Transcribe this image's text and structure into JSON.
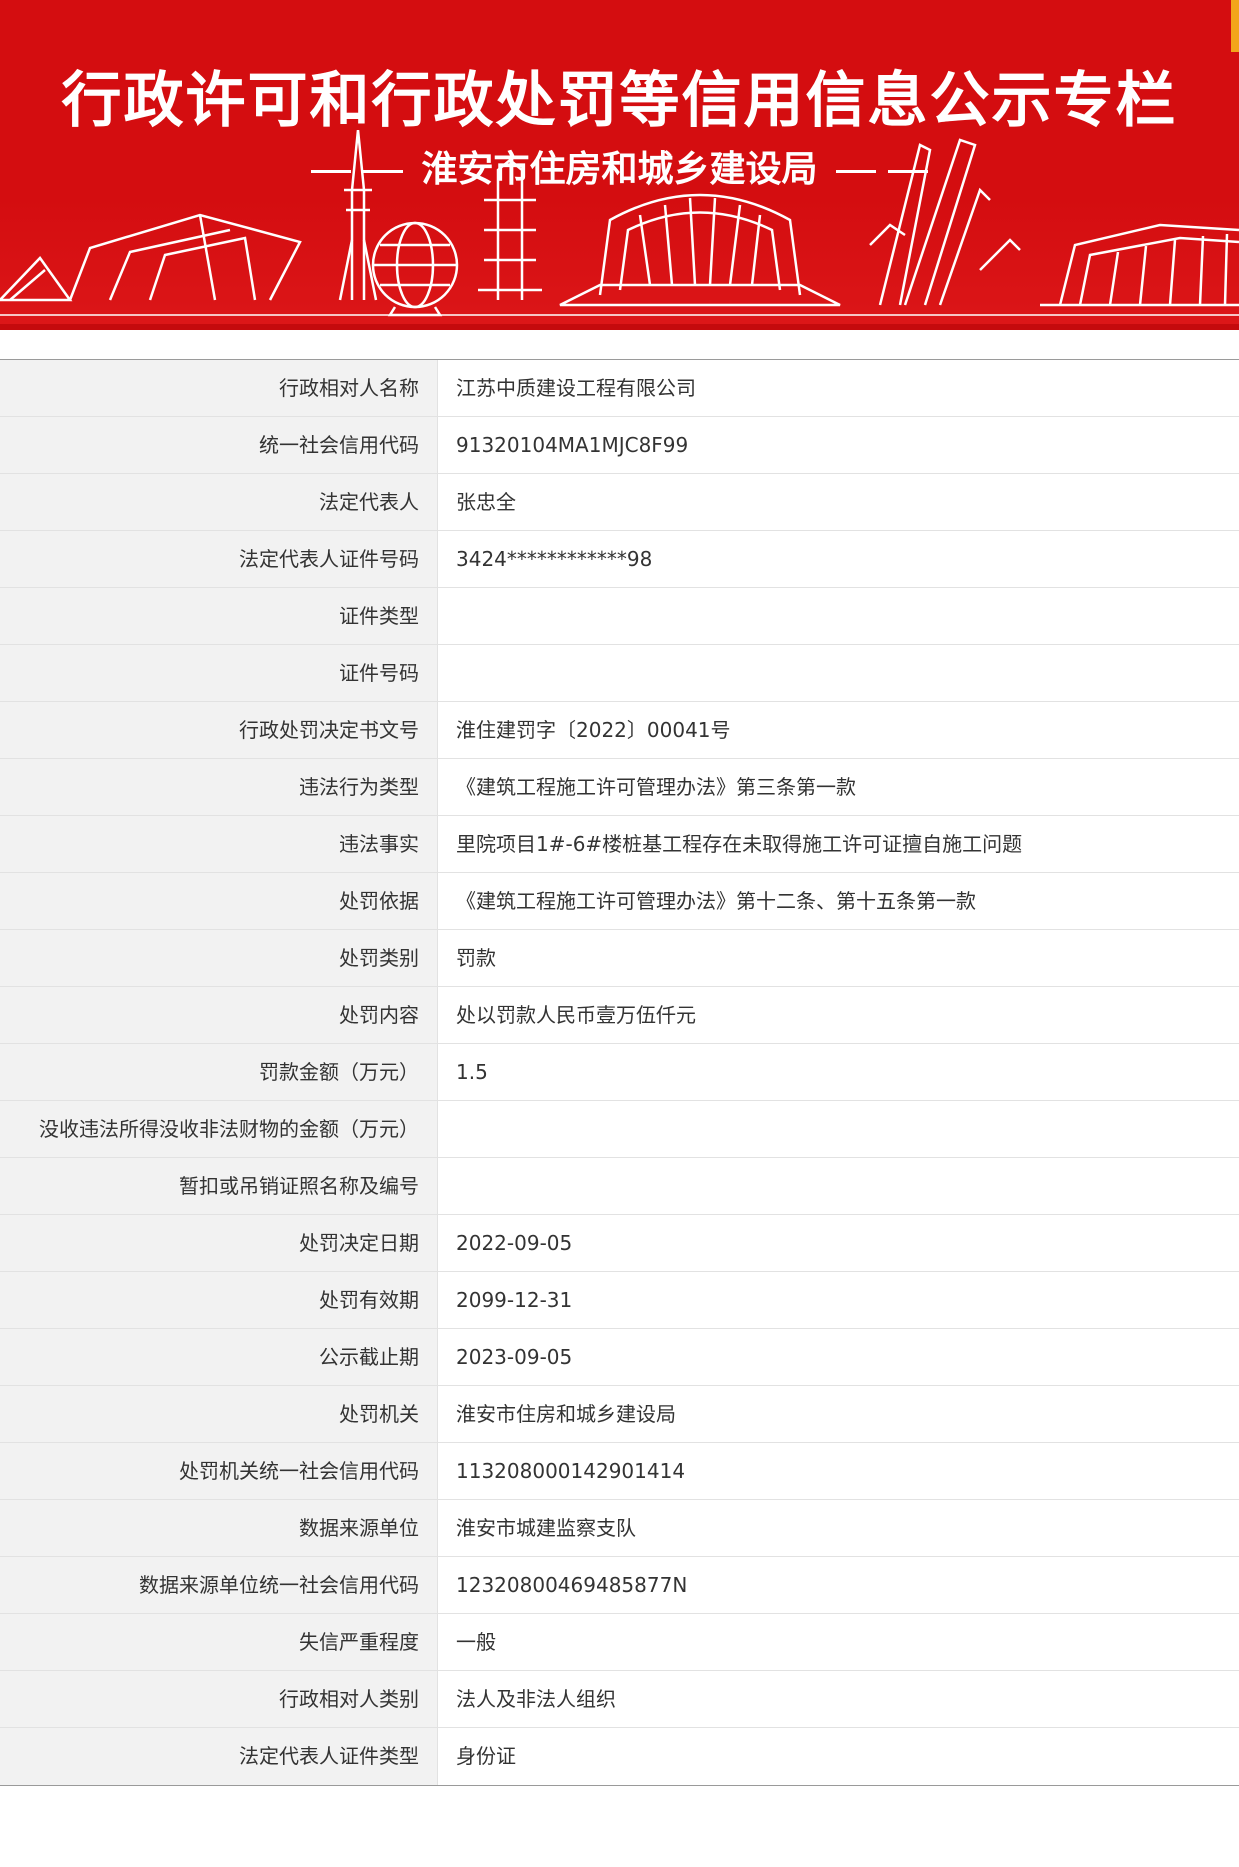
{
  "banner": {
    "title": "行政许可和行政处罚等信用信息公示专栏",
    "subtitle": "淮安市住房和城乡建设局",
    "colors": {
      "background": "#d40d10",
      "accent": "#f3a51b",
      "text": "#ffffff"
    }
  },
  "rows": [
    {
      "label": "行政相对人名称",
      "value": "江苏中质建设工程有限公司"
    },
    {
      "label": "统一社会信用代码",
      "value": "91320104MA1MJC8F99"
    },
    {
      "label": "法定代表人",
      "value": "张忠全"
    },
    {
      "label": "法定代表人证件号码",
      "value": "3424************98"
    },
    {
      "label": "证件类型",
      "value": ""
    },
    {
      "label": "证件号码",
      "value": ""
    },
    {
      "label": "行政处罚决定书文号",
      "value": "淮住建罚字〔2022〕00041号"
    },
    {
      "label": "违法行为类型",
      "value": "《建筑工程施工许可管理办法》第三条第一款"
    },
    {
      "label": "违法事实",
      "value": "里院项目1#-6#楼桩基工程存在未取得施工许可证擅自施工问题"
    },
    {
      "label": "处罚依据",
      "value": "《建筑工程施工许可管理办法》第十二条、第十五条第一款"
    },
    {
      "label": "处罚类别",
      "value": "罚款"
    },
    {
      "label": "处罚内容",
      "value": "处以罚款人民币壹万伍仟元"
    },
    {
      "label": "罚款金额（万元）",
      "value": "1.5"
    },
    {
      "label": "没收违法所得没收非法财物的金额（万元）",
      "value": ""
    },
    {
      "label": "暂扣或吊销证照名称及编号",
      "value": ""
    },
    {
      "label": "处罚决定日期",
      "value": "2022-09-05"
    },
    {
      "label": "处罚有效期",
      "value": "2099-12-31"
    },
    {
      "label": "公示截止期",
      "value": "2023-09-05"
    },
    {
      "label": "处罚机关",
      "value": "淮安市住房和城乡建设局"
    },
    {
      "label": "处罚机关统一社会信用代码",
      "value": "113208000142901414"
    },
    {
      "label": "数据来源单位",
      "value": "淮安市城建监察支队"
    },
    {
      "label": "数据来源单位统一社会信用代码",
      "value": "12320800469485877N"
    },
    {
      "label": "失信严重程度",
      "value": "一般"
    },
    {
      "label": "行政相对人类别",
      "value": "法人及非法人组织"
    },
    {
      "label": "法定代表人证件类型",
      "value": "身份证"
    }
  ]
}
